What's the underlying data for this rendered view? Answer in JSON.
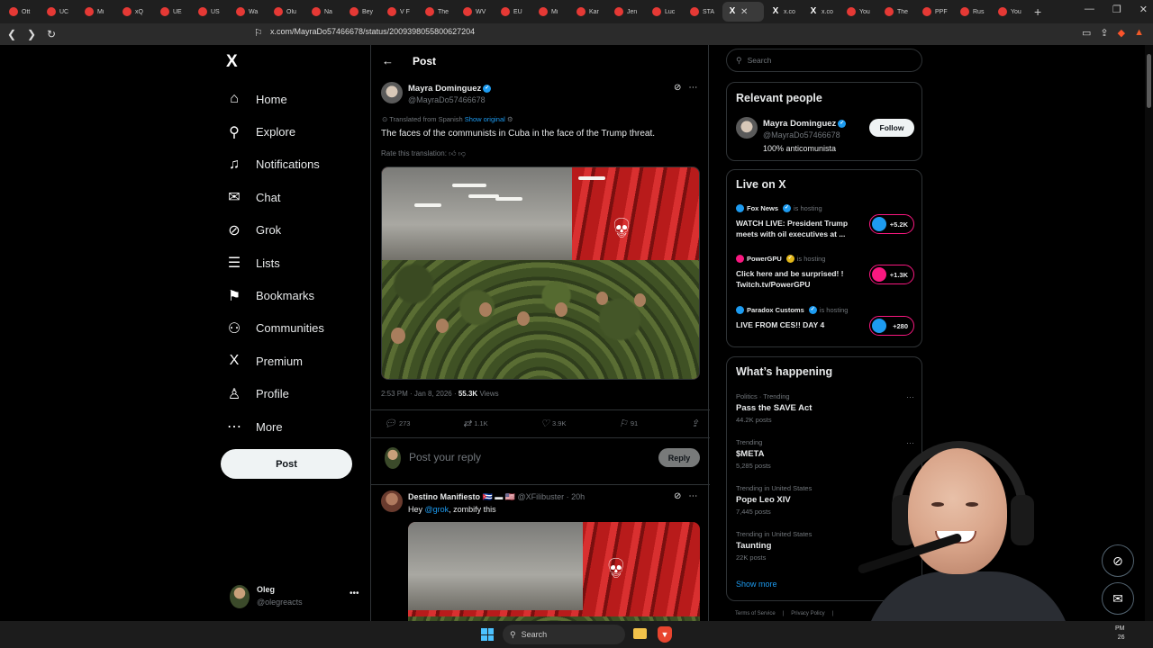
{
  "browser": {
    "tabs": [
      {
        "label": "Ott",
        "favicon": "youtube-icon"
      },
      {
        "label": "UC",
        "favicon": "youtube-icon"
      },
      {
        "label": "Mi",
        "favicon": "youtube-icon"
      },
      {
        "label": "xQ",
        "favicon": "youtube-icon"
      },
      {
        "label": "UE",
        "favicon": "youtube-icon"
      },
      {
        "label": "US",
        "favicon": "youtube-icon"
      },
      {
        "label": "Wa",
        "favicon": "youtube-icon"
      },
      {
        "label": "Olu",
        "favicon": "youtube-icon"
      },
      {
        "label": "Na",
        "favicon": "youtube-icon"
      },
      {
        "label": "Bey",
        "favicon": "youtube-icon"
      },
      {
        "label": "V F",
        "favicon": "youtube-icon"
      },
      {
        "label": "The",
        "favicon": "youtube-icon"
      },
      {
        "label": "WV",
        "favicon": "youtube-icon"
      },
      {
        "label": "EU",
        "favicon": "youtube-icon"
      },
      {
        "label": "Mi",
        "favicon": "youtube-icon"
      },
      {
        "label": "Kar",
        "favicon": "youtube-icon"
      },
      {
        "label": "Jen",
        "favicon": "youtube-icon"
      },
      {
        "label": "Luc",
        "favicon": "youtube-icon"
      },
      {
        "label": "STA",
        "favicon": "youtube-icon"
      }
    ],
    "active_tab_favicon": "X",
    "after_tabs": [
      {
        "label": "x.co",
        "favicon": "X"
      },
      {
        "label": "x.co",
        "favicon": "X"
      },
      {
        "label": "You",
        "favicon": "youtube-icon"
      },
      {
        "label": "The",
        "favicon": "youtube-icon"
      },
      {
        "label": "PPF",
        "favicon": "youtube-icon"
      },
      {
        "label": "Rus",
        "favicon": "youtube-icon"
      },
      {
        "label": "You",
        "favicon": "youtube-icon"
      }
    ],
    "url": "x.com/MayraDo57466678/status/2009398055800627204"
  },
  "nav": {
    "logo": "X",
    "items": [
      {
        "label": "Home",
        "icon": "⌂"
      },
      {
        "label": "Explore",
        "icon": "⚲"
      },
      {
        "label": "Notifications",
        "icon": "♫"
      },
      {
        "label": "Chat",
        "icon": "✉"
      },
      {
        "label": "Grok",
        "icon": "⊘"
      },
      {
        "label": "Lists",
        "icon": "☰"
      },
      {
        "label": "Bookmarks",
        "icon": "⚑"
      },
      {
        "label": "Communities",
        "icon": "⚇"
      },
      {
        "label": "Premium",
        "icon": "X"
      },
      {
        "label": "Profile",
        "icon": "♙"
      },
      {
        "label": "More",
        "icon": "⋯"
      }
    ],
    "post_button": "Post",
    "account": {
      "name": "Oleg",
      "handle": "@olegreacts"
    }
  },
  "post": {
    "header": "Post",
    "author": "Mayra Dominguez",
    "handle": "@MayraDo57466678",
    "translated_from": "Translated from Spanish",
    "show_original": "Show original",
    "text": "The faces of the communists in Cuba in the face of the Trump threat.",
    "rate_translation": "Rate this translation:",
    "time": "2:53 PM · Jan 8, 2026 ·",
    "views": "55.3K",
    "views_label": "Views",
    "stats": {
      "replies": "273",
      "reposts": "1.1K",
      "likes": "3.9K",
      "bookmarks": "91"
    }
  },
  "reply_box": {
    "placeholder": "Post your reply",
    "button": "Reply"
  },
  "reply": {
    "author": "Destino Manifiesto",
    "handle": "@XFilibuster · 20h",
    "text_prefix": "Hey ",
    "mention": "@grok",
    "text_suffix": ", zombify this"
  },
  "sidebar": {
    "search_placeholder": "Search",
    "relevant": {
      "title": "Relevant people",
      "name": "Mayra Dominguez",
      "handle": "@MayraDo57466678",
      "bio": "100% anticomunista",
      "follow": "Follow"
    },
    "live": {
      "title": "Live on X",
      "hosting": "is hosting",
      "items": [
        {
          "host": "Fox News",
          "title": "WATCH LIVE: President Trump meets with oil executives at ...",
          "count": "+5.2K",
          "color": "#1d9bf0"
        },
        {
          "host": "PowerGPU",
          "title": "Click here and be surprised! ! Twitch.tv/PowerGPU",
          "count": "+1.3K",
          "color": "#f91880"
        },
        {
          "host": "Paradox Customs",
          "title": "LIVE FROM CES!! DAY 4",
          "count": "+280",
          "color": "#1d9bf0"
        }
      ]
    },
    "happening": {
      "title": "What’s happening",
      "trends": [
        {
          "context": "Politics · Trending",
          "name": "Pass the SAVE Act",
          "posts": "44.2K posts"
        },
        {
          "context": "Trending",
          "name": "$META",
          "posts": "5,285 posts"
        },
        {
          "context": "Trending in United States",
          "name": "Pope Leo XIV",
          "posts": "7,445 posts"
        },
        {
          "context": "Trending in United States",
          "name": "Taunting",
          "posts": "22K posts"
        }
      ],
      "show_more": "Show more"
    },
    "footer": [
      "Terms of Service",
      "|",
      "Privacy Policy",
      "|"
    ]
  },
  "taskbar": {
    "search": "Search",
    "clock_top": "PM",
    "clock_bottom": "26"
  }
}
